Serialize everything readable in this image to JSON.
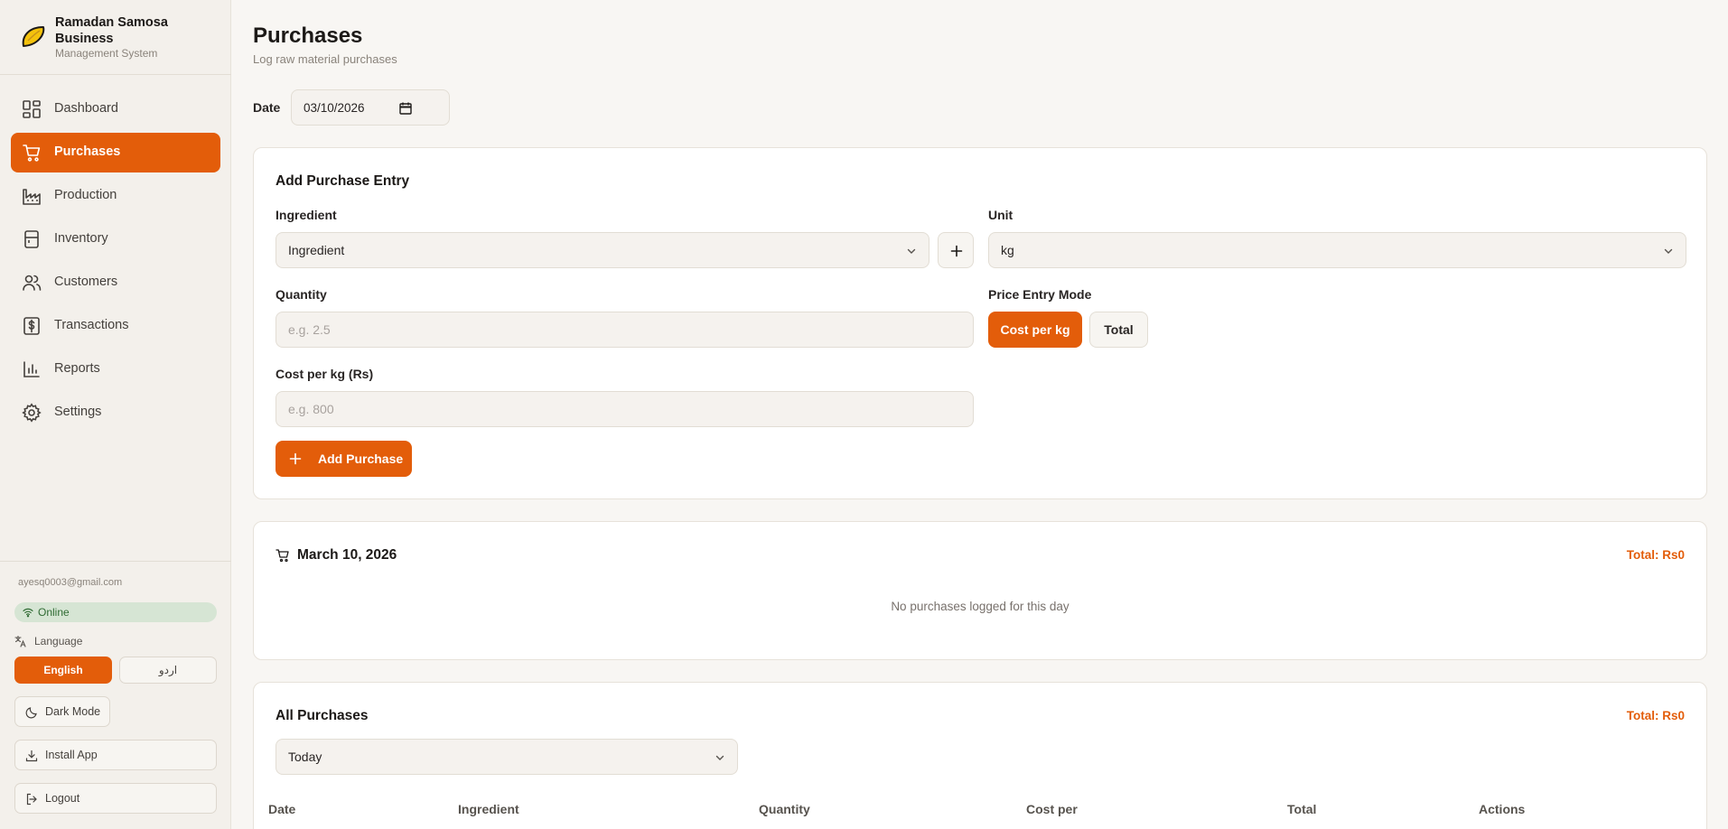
{
  "brand": {
    "title": "Ramadan Samosa Business",
    "subtitle": "Management System",
    "logo_icon": "samosa-icon"
  },
  "nav": {
    "items": [
      {
        "label": "Dashboard",
        "icon": "dashboard-icon"
      },
      {
        "label": "Purchases",
        "icon": "cart-icon",
        "active": true
      },
      {
        "label": "Production",
        "icon": "factory-icon"
      },
      {
        "label": "Inventory",
        "icon": "inventory-icon"
      },
      {
        "label": "Customers",
        "icon": "users-icon"
      },
      {
        "label": "Transactions",
        "icon": "receipt-icon"
      },
      {
        "label": "Reports",
        "icon": "bar-chart-icon"
      },
      {
        "label": "Settings",
        "icon": "gear-icon"
      }
    ]
  },
  "account": {
    "email": "ayesq0003@gmail.com",
    "status": "Online",
    "language_label": "Language",
    "lang_english": "English",
    "lang_urdu": "اردو",
    "dark_mode": "Dark Mode",
    "install_app": "Install App",
    "logout": "Logout"
  },
  "header": {
    "title": "Purchases",
    "subtitle": "Log raw material purchases",
    "date_label": "Date",
    "date_value": "03/10/2026"
  },
  "entry_form": {
    "title": "Add Purchase Entry",
    "ingredient_label": "Ingredient",
    "ingredient_value": "Ingredient",
    "unit_label": "Unit",
    "unit_value": "kg",
    "quantity_label": "Quantity",
    "quantity_placeholder": "e.g. 2.5",
    "price_mode_label": "Price Entry Mode",
    "mode_cost_per_kg": "Cost per kg",
    "mode_total": "Total",
    "cost_label": "Cost per kg (Rs)",
    "cost_placeholder": "e.g. 800",
    "submit": "Add Purchase"
  },
  "day_summary": {
    "date": "March 10, 2026",
    "total": "Total: Rs0",
    "empty_text": "No purchases logged for this day"
  },
  "all_purchases": {
    "title": "All Purchases",
    "total": "Total: Rs0",
    "filter_value": "Today",
    "columns": [
      "Date",
      "Ingredient",
      "Quantity",
      "Cost per",
      "Total",
      "Actions"
    ]
  },
  "colors": {
    "accent": "#e35d0a",
    "sidebar_bg": "#f3f0eb",
    "page_bg": "#f8f6f3",
    "online_bg": "#d6e5d4",
    "online_text": "#2f6b33"
  }
}
